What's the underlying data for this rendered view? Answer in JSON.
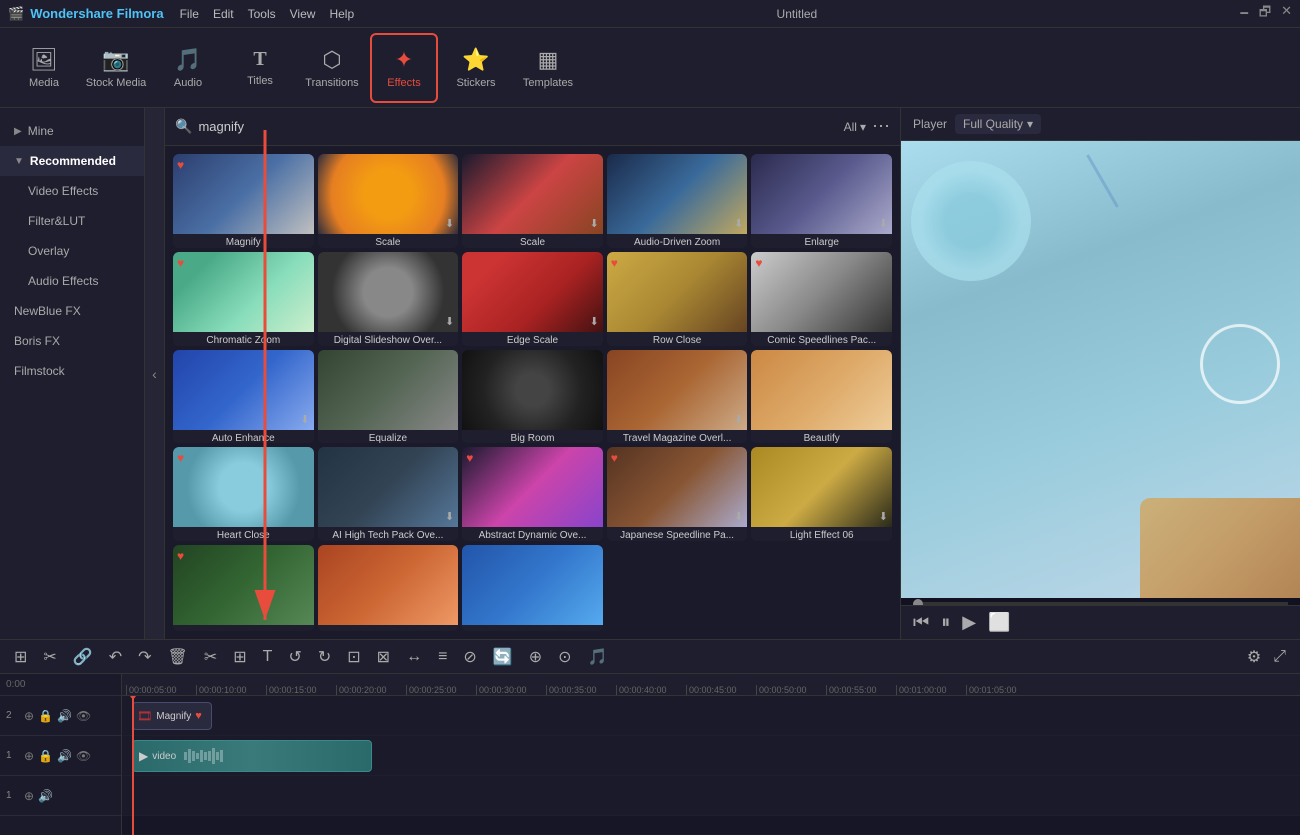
{
  "app": {
    "name": "Wondershare Filmora",
    "title": "Untitled",
    "logo_icon": "🎬"
  },
  "menu": {
    "items": [
      "File",
      "Edit",
      "Tools",
      "View",
      "Help"
    ]
  },
  "toolbar": {
    "items": [
      {
        "id": "media",
        "label": "Media",
        "icon": "🖼"
      },
      {
        "id": "stock",
        "label": "Stock Media",
        "icon": "📷"
      },
      {
        "id": "audio",
        "label": "Audio",
        "icon": "🎵"
      },
      {
        "id": "titles",
        "label": "Titles",
        "icon": "T"
      },
      {
        "id": "transitions",
        "label": "Transitions",
        "icon": "⬡"
      },
      {
        "id": "effects",
        "label": "Effects",
        "icon": "✦",
        "active": true
      },
      {
        "id": "stickers",
        "label": "Stickers",
        "icon": "⭐"
      },
      {
        "id": "templates",
        "label": "Templates",
        "icon": "▦"
      }
    ]
  },
  "sidebar": {
    "items": [
      {
        "id": "mine",
        "label": "Mine",
        "active": false
      },
      {
        "id": "recommended",
        "label": "Recommended",
        "active": true
      },
      {
        "id": "video-effects",
        "label": "Video Effects",
        "active": false
      },
      {
        "id": "filter-lut",
        "label": "Filter&LUT",
        "active": false
      },
      {
        "id": "overlay",
        "label": "Overlay",
        "active": false
      },
      {
        "id": "audio-effects",
        "label": "Audio Effects",
        "active": false
      },
      {
        "id": "newblue-fx",
        "label": "NewBlue FX",
        "active": false
      },
      {
        "id": "boris-fx",
        "label": "Boris FX",
        "active": false
      },
      {
        "id": "filmstock",
        "label": "Filmstock",
        "active": false
      }
    ]
  },
  "search": {
    "placeholder": "magnify",
    "filter_label": "All",
    "filter_arrow": "▾"
  },
  "effects": {
    "grid": [
      {
        "id": "magnify",
        "label": "Magnify",
        "thumb_class": "thumb-magnify",
        "heart": true,
        "download": false
      },
      {
        "id": "scale1",
        "label": "Scale",
        "thumb_class": "thumb-scale1",
        "heart": false,
        "download": true
      },
      {
        "id": "scale2",
        "label": "Scale",
        "thumb_class": "thumb-scale2",
        "heart": false,
        "download": true
      },
      {
        "id": "audio-zoom",
        "label": "Audio-Driven Zoom",
        "thumb_class": "thumb-audiozoom",
        "heart": false,
        "download": true
      },
      {
        "id": "enlarge",
        "label": "Enlarge",
        "thumb_class": "thumb-enlarge",
        "heart": false,
        "download": true
      },
      {
        "id": "chromatic",
        "label": "Chromatic Zoom",
        "thumb_class": "thumb-chromatic",
        "heart": true,
        "download": false
      },
      {
        "id": "digital",
        "label": "Digital Slideshow Over...",
        "thumb_class": "thumb-digital",
        "heart": false,
        "download": true
      },
      {
        "id": "edge",
        "label": "Edge Scale",
        "thumb_class": "thumb-edge",
        "heart": false,
        "download": true
      },
      {
        "id": "rowclose",
        "label": "Row Close",
        "thumb_class": "thumb-rowclose",
        "heart": true,
        "download": false
      },
      {
        "id": "comic",
        "label": "Comic Speedlines Pac...",
        "thumb_class": "thumb-comic",
        "heart": true,
        "download": false
      },
      {
        "id": "autoenhance",
        "label": "Auto Enhance",
        "thumb_class": "thumb-autoenhance",
        "heart": false,
        "download": true
      },
      {
        "id": "equalize",
        "label": "Equalize",
        "thumb_class": "thumb-equalize",
        "heart": false,
        "download": false
      },
      {
        "id": "bigroom",
        "label": "Big Room",
        "thumb_class": "thumb-bigroom",
        "heart": false,
        "download": false
      },
      {
        "id": "travel",
        "label": "Travel Magazine Overl...",
        "thumb_class": "thumb-travel",
        "heart": false,
        "download": true
      },
      {
        "id": "beautify",
        "label": "Beautify",
        "thumb_class": "thumb-beautify",
        "heart": false,
        "download": false
      },
      {
        "id": "heartclose",
        "label": "Heart Close",
        "thumb_class": "thumb-heartclose",
        "heart": true,
        "download": false
      },
      {
        "id": "aitech",
        "label": "AI High Tech Pack Ove...",
        "thumb_class": "thumb-aitech",
        "heart": false,
        "download": true
      },
      {
        "id": "abstract",
        "label": "Abstract Dynamic Ove...",
        "thumb_class": "thumb-abstract",
        "heart": true,
        "download": false
      },
      {
        "id": "japanese",
        "label": "Japanese Speedline Pa...",
        "thumb_class": "thumb-japanese",
        "heart": true,
        "download": true
      },
      {
        "id": "lighteffect",
        "label": "Light Effect 06",
        "thumb_class": "thumb-lighteffect",
        "heart": false,
        "download": true
      },
      {
        "id": "more1",
        "label": "",
        "thumb_class": "thumb-more1",
        "heart": true,
        "download": false
      },
      {
        "id": "more2",
        "label": "",
        "thumb_class": "thumb-more2",
        "heart": false,
        "download": false
      },
      {
        "id": "more3",
        "label": "",
        "thumb_class": "thumb-more3",
        "heart": false,
        "download": false
      }
    ]
  },
  "player": {
    "label": "Player",
    "quality": "Full Quality",
    "controls": [
      "⏮",
      "⏸",
      "▶",
      "⬜"
    ]
  },
  "timeline": {
    "ruler_marks": [
      "00:00:05:00",
      "00:00:10:00",
      "00:00:15:00",
      "00:00:20:00",
      "00:00:25:00",
      "00:00:30:00",
      "00:00:35:00",
      "00:00:40:00",
      "00:00:45:00",
      "00:00:50:00",
      "00:00:55:00",
      "00:01:00:00",
      "00:01:05:00"
    ],
    "tracks": [
      {
        "num": "2",
        "type": "effect",
        "clip_label": "Magnify",
        "clip_heart": true
      },
      {
        "num": "1",
        "type": "video",
        "clip_label": "video"
      },
      {
        "num": "1",
        "type": "audio"
      }
    ],
    "toolbar_buttons": [
      "⊞",
      "✂",
      "🔗",
      "↶",
      "↷",
      "🗑",
      "✂",
      "⊞",
      "T",
      "↺",
      "↻",
      "⊡",
      "⊠",
      "↔",
      "≡",
      "⊘",
      "🔄",
      "⊕",
      "⊙",
      "🎵"
    ]
  }
}
